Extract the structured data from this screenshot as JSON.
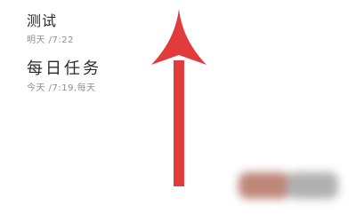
{
  "tasks": [
    {
      "title": "测试",
      "subtitle": "明天 /7:22"
    },
    {
      "title": "每日任务",
      "subtitle": "今天 /7:19,每天"
    }
  ],
  "annotation": {
    "arrow_direction": "up",
    "arrow_color": "#e23b3b"
  },
  "buttons": {
    "primary_color": "#b77a6a",
    "secondary_color": "#a8a8a8"
  }
}
